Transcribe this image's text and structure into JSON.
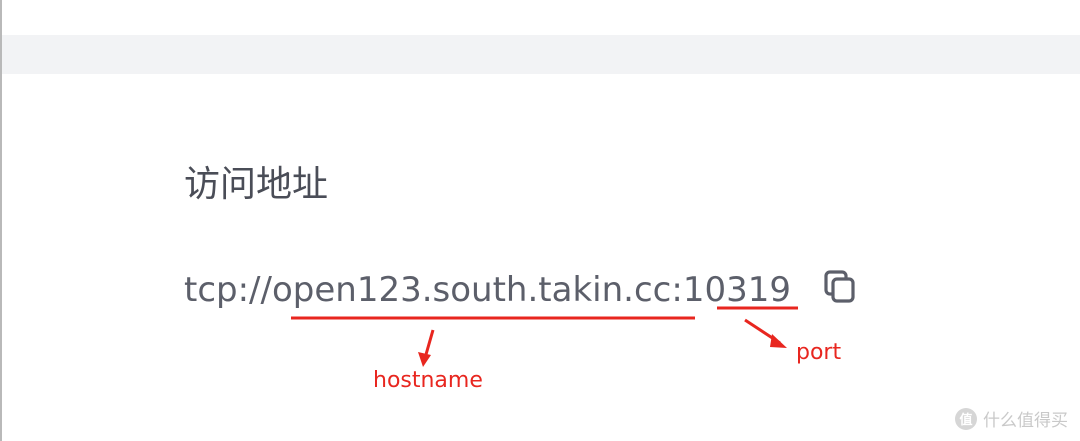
{
  "section": {
    "title": "访问地址"
  },
  "address": {
    "scheme": "tcp://",
    "hostname": "open123.south.takin.cc",
    "separator": ":",
    "port": "10319"
  },
  "copy_button": {
    "icon": "copy-icon"
  },
  "annotations": {
    "hostname_label": "hostname",
    "port_label": "port",
    "color": "#e8261f"
  },
  "watermark": {
    "text": "什么值得买",
    "logo_glyph": "值"
  }
}
